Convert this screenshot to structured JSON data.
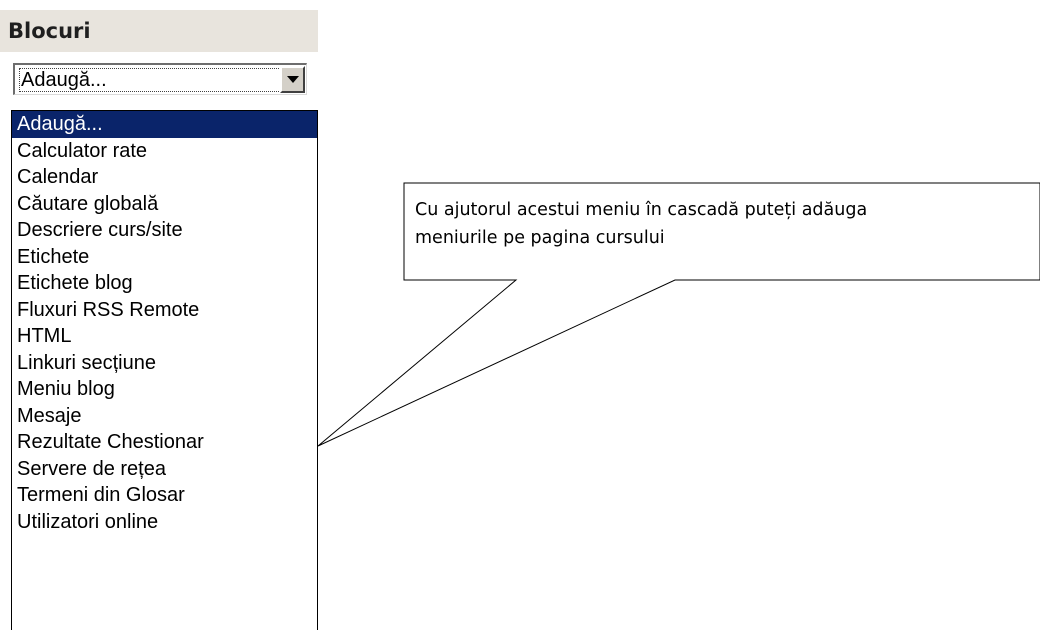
{
  "block": {
    "title": "Blocuri"
  },
  "select": {
    "value": "Adaugă...",
    "arrow_icon": "chevron-down-icon"
  },
  "dropdown": {
    "options": [
      "Adaugă...",
      "Calculator rate",
      "Calendar",
      "Căutare globală",
      "Descriere curs/site",
      "Etichete",
      "Etichete blog",
      "Fluxuri RSS Remote",
      "HTML",
      "Linkuri secțiune",
      "Meniu blog",
      "Mesaje",
      "Rezultate Chestionar",
      "Servere de rețea",
      "Termeni din Glosar",
      "Utilizatori online"
    ],
    "highlight_color": "#0a246a"
  },
  "callout": {
    "line1": "Cu ajutorul acestui meniu în cascadă puteți adăuga",
    "line2": "meniurile pe pagina cursului"
  }
}
